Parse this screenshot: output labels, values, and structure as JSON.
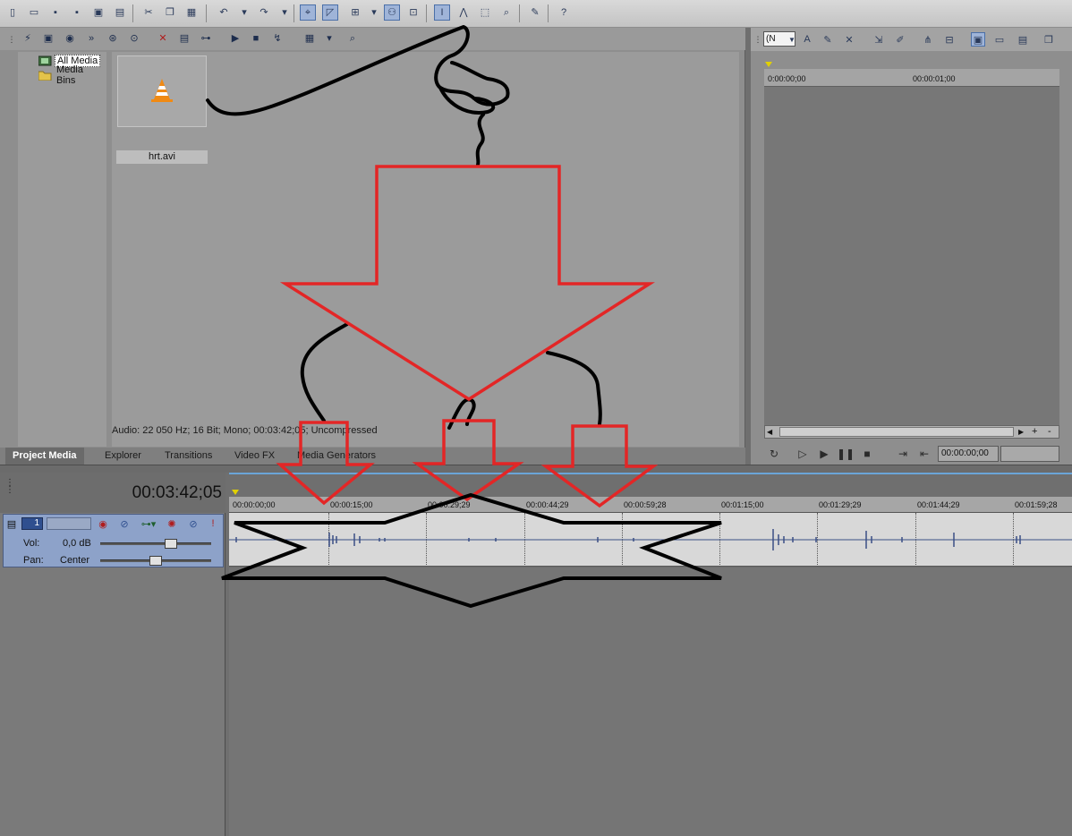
{
  "media": {
    "tree_items": [
      {
        "label": "All Media",
        "selected": true
      },
      {
        "label": "Media Bins",
        "selected": false
      }
    ],
    "file_name": "hrt.avi",
    "status_text": "Audio: 22 050 Hz; 16 Bit; Mono; 00:03:42;05; Uncompressed",
    "tabs": [
      "Project Media",
      "Explorer",
      "Transitions",
      "Video FX",
      "Media Generators"
    ]
  },
  "preview": {
    "select_value": "(N",
    "ruler_labels": [
      "0:00:00;00",
      "00:00:01;00"
    ],
    "time": "00:00:00;00"
  },
  "timeline": {
    "timecode": "00:03:42;05",
    "ruler_labels": [
      "00:00:00;00",
      "00:00:15;00",
      "00:00:29;29",
      "00:00:44;29",
      "00:00:59;28",
      "00:01:15;00",
      "00:01:29;29",
      "00:01:44;29",
      "00:01:59;28"
    ],
    "track": {
      "number": "1",
      "vol_label": "Vol:",
      "vol_value": "0,0 dB",
      "pan_label": "Pan:",
      "pan_value": "Center"
    }
  },
  "colors": {
    "annotation_red": "#e32626",
    "annotation_black": "#000000",
    "waveform": "#3a4f86",
    "track_header": "#8da2c9"
  },
  "icons": {
    "main_toolbar": [
      "new-icon",
      "open-icon",
      "save-icon",
      "save-as-icon",
      "render-icon",
      "properties-icon",
      "cut-icon",
      "copy-icon",
      "paste-icon",
      "undo-icon",
      "redo-icon",
      "snap-icon",
      "auto-crossfade-icon",
      "ripple-icon",
      "lock-envelopes-icon",
      "ignore-grouping-icon",
      "normal-edit-tool-icon",
      "envelope-tool-icon",
      "selection-tool-icon",
      "zoom-tool-icon",
      "markers-icon",
      "help-icon"
    ],
    "media_toolbar": [
      "import-media-icon",
      "capture-video-icon",
      "get-media-web-icon",
      "media-fx-icon",
      "search-icon",
      "remove-media-icon",
      "properties-icon",
      "media-fx-chain-icon",
      "play-icon",
      "stop-icon",
      "auto-preview-icon",
      "views-icon",
      "zoom-icon"
    ]
  }
}
